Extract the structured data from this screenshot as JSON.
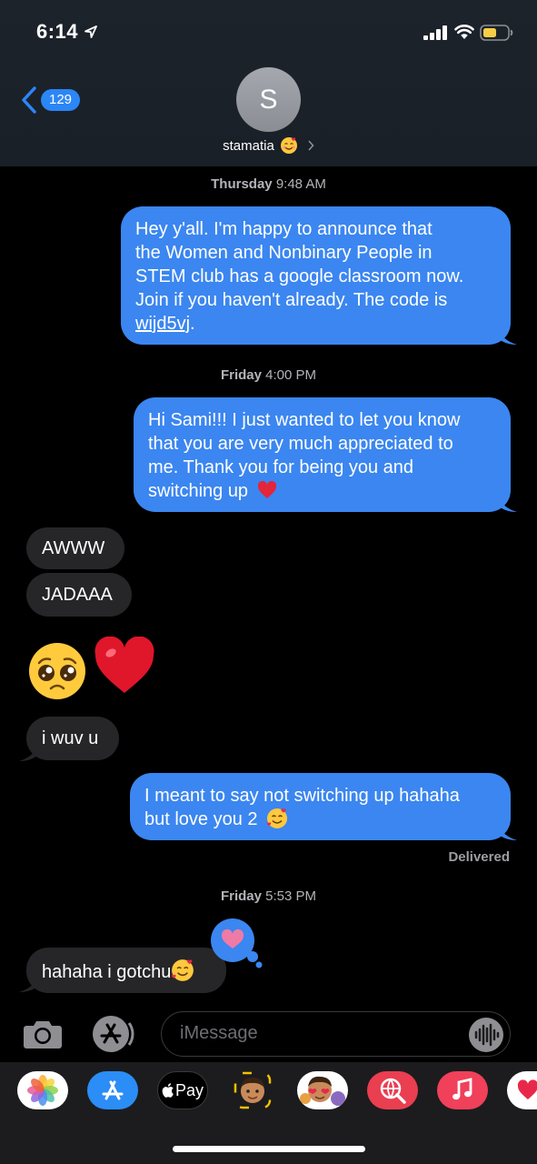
{
  "status_bar": {
    "time": "6:14"
  },
  "header": {
    "back_count": "129",
    "avatar_initial": "S",
    "contact_name": "stamatia"
  },
  "messages": [
    {
      "type": "timestamp",
      "day": "Thursday",
      "time": "9:48 AM"
    },
    {
      "type": "outgoing",
      "lines": [
        "Hey y'all. I'm happy to announce that",
        "the Women and Nonbinary People in",
        "STEM club has a google classroom now.",
        "Join if you haven't already. The code is"
      ],
      "code": "wijd5vj",
      "code_after": "."
    },
    {
      "type": "timestamp",
      "day": "Friday",
      "time": "4:00 PM"
    },
    {
      "type": "outgoing",
      "lines": [
        "Hi Sami!!! I just wanted to let you know",
        "that you are very much appreciated to",
        "me. Thank you for being you and"
      ],
      "last_line": "switching up",
      "emoji": "red-heart"
    },
    {
      "type": "incoming",
      "text": "AWWW"
    },
    {
      "type": "incoming",
      "text": "JADAAA"
    },
    {
      "type": "incoming-emoji",
      "emojis": [
        "pleading-face",
        "red-heart"
      ]
    },
    {
      "type": "incoming",
      "text": "i wuv u"
    },
    {
      "type": "outgoing",
      "lines": [
        "I meant to say not switching up hahaha"
      ],
      "last_line": "but love you 2",
      "emoji": "smiling-face-with-hearts",
      "status": "Delivered"
    },
    {
      "type": "timestamp",
      "day": "Friday",
      "time": "5:53 PM"
    },
    {
      "type": "incoming",
      "text": "hahaha i gotchu",
      "emoji": "smiling-face-with-hearts",
      "tapback": "heart"
    }
  ],
  "input": {
    "placeholder": "iMessage"
  },
  "app_drawer": {
    "apps": [
      "photos",
      "app-store",
      "apple-pay",
      "memoji",
      "animoji-stickers",
      "web-search",
      "music",
      "digital-touch"
    ],
    "apple_pay_label": "Pay"
  },
  "colors": {
    "outgoing_bubble": "#3b86f0",
    "incoming_bubble": "#262628",
    "accent": "#2b86f6",
    "background": "#000000"
  }
}
